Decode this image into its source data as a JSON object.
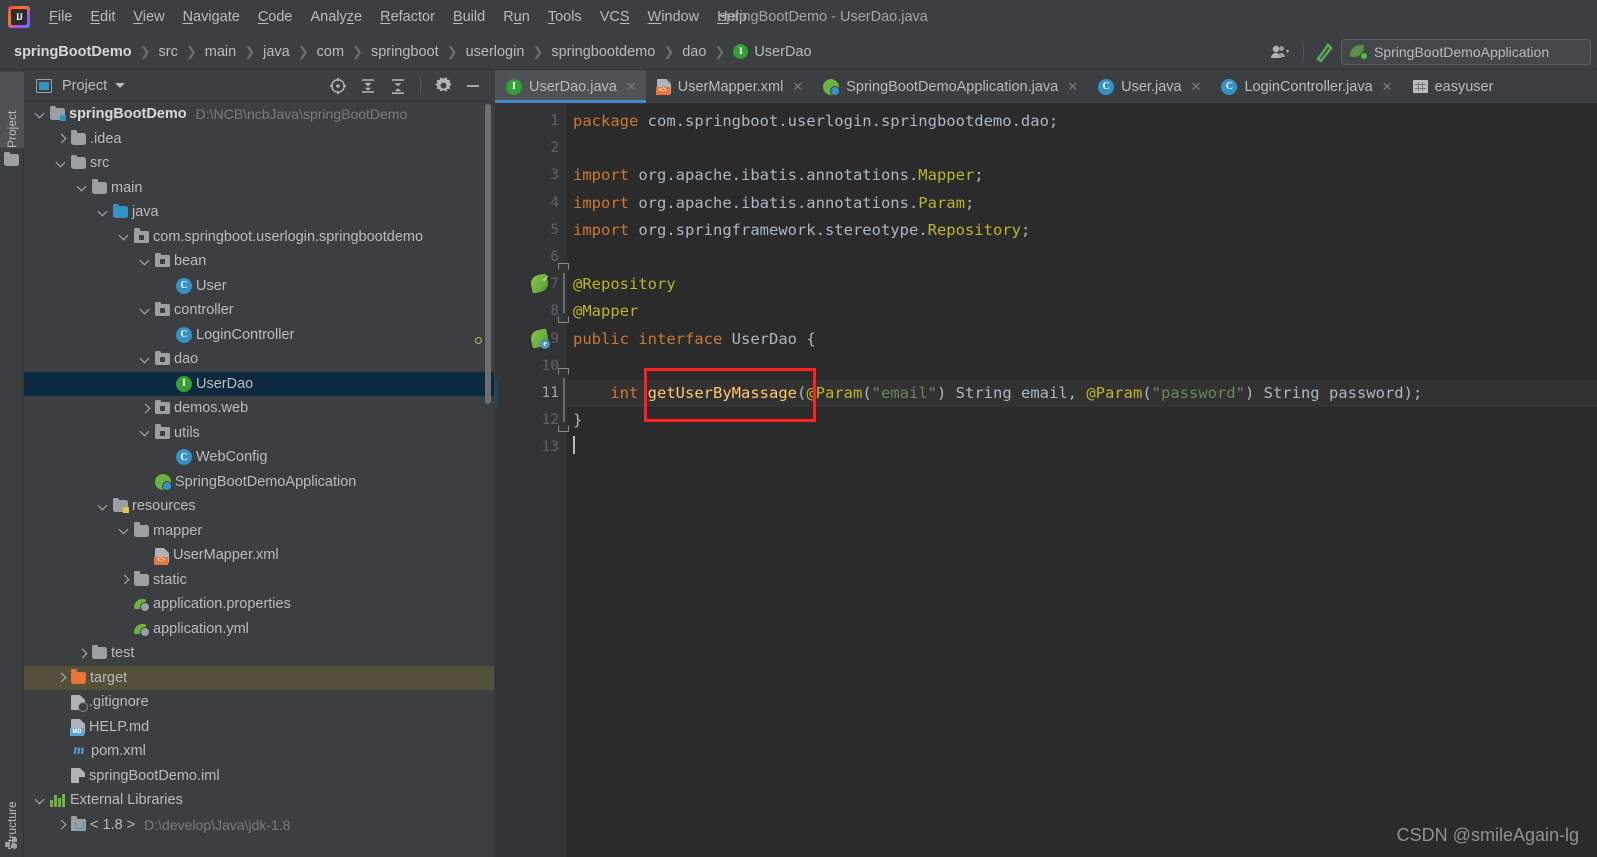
{
  "window": {
    "title": "springBootDemo - UserDao.java"
  },
  "menubar": {
    "items": [
      {
        "label": "File",
        "mnemonic": "F"
      },
      {
        "label": "Edit",
        "mnemonic": "E"
      },
      {
        "label": "View",
        "mnemonic": "V"
      },
      {
        "label": "Navigate",
        "mnemonic": "N"
      },
      {
        "label": "Code",
        "mnemonic": "C"
      },
      {
        "label": "Analyze",
        "mnemonic": "z"
      },
      {
        "label": "Refactor",
        "mnemonic": "R"
      },
      {
        "label": "Build",
        "mnemonic": "B"
      },
      {
        "label": "Run",
        "mnemonic": "u"
      },
      {
        "label": "Tools",
        "mnemonic": "T"
      },
      {
        "label": "VCS",
        "mnemonic": "S"
      },
      {
        "label": "Window",
        "mnemonic": "W"
      },
      {
        "label": "Help",
        "mnemonic": "H"
      }
    ]
  },
  "breadcrumb": {
    "items": [
      "springBootDemo",
      "src",
      "main",
      "java",
      "com",
      "springboot",
      "userlogin",
      "springbootdemo",
      "dao",
      "UserDao"
    ],
    "last_icon": "interface-icon",
    "last_icon_letter": "I"
  },
  "toolbar_right": {
    "account_icon": "user-account-icon",
    "search_icon": "search-everywhere-icon",
    "run_config_label": "SpringBootDemoApplication",
    "run_config_icon": "spring-boot-icon"
  },
  "left_stripe": {
    "top_tab": "Project",
    "bottom_tab": "Structure"
  },
  "project_panel": {
    "title": "Project",
    "title_icon": "project-view-icon",
    "caret_icon": "chevron-down-icon",
    "actions": [
      {
        "name": "scroll-from-source-icon"
      },
      {
        "name": "expand-all-icon"
      },
      {
        "name": "collapse-all-icon"
      },
      {
        "name": "settings-gear-icon"
      },
      {
        "name": "hide-minimize-icon"
      }
    ],
    "tree": [
      {
        "indent": 0,
        "arrow": "down",
        "icon": "folder-module",
        "label": "springBootDemo",
        "bold": true,
        "path": "D:\\NCB\\ncbJava\\springBootDemo",
        "state": "normal"
      },
      {
        "indent": 1,
        "arrow": "right",
        "icon": "folder",
        "label": ".idea",
        "bold": false,
        "path": "",
        "state": "normal"
      },
      {
        "indent": 1,
        "arrow": "down",
        "icon": "folder",
        "label": "src",
        "bold": false,
        "path": "",
        "state": "normal"
      },
      {
        "indent": 2,
        "arrow": "down",
        "icon": "folder",
        "label": "main",
        "bold": false,
        "path": "",
        "state": "normal"
      },
      {
        "indent": 3,
        "arrow": "down",
        "icon": "folder-source",
        "label": "java",
        "bold": false,
        "path": "",
        "state": "normal"
      },
      {
        "indent": 4,
        "arrow": "down",
        "icon": "package",
        "label": "com.springboot.userlogin.springbootdemo",
        "bold": false,
        "path": "",
        "state": "normal"
      },
      {
        "indent": 5,
        "arrow": "down",
        "icon": "package",
        "label": "bean",
        "bold": false,
        "path": "",
        "state": "normal"
      },
      {
        "indent": 6,
        "arrow": "none",
        "icon": "class",
        "label": "User",
        "bold": false,
        "path": "",
        "state": "normal"
      },
      {
        "indent": 5,
        "arrow": "down",
        "icon": "package",
        "label": "controller",
        "bold": false,
        "path": "",
        "state": "normal"
      },
      {
        "indent": 6,
        "arrow": "none",
        "icon": "class",
        "label": "LoginController",
        "bold": false,
        "path": "",
        "state": "normal"
      },
      {
        "indent": 5,
        "arrow": "down",
        "icon": "package",
        "label": "dao",
        "bold": false,
        "path": "",
        "state": "normal"
      },
      {
        "indent": 6,
        "arrow": "none",
        "icon": "interface",
        "label": "UserDao",
        "bold": false,
        "path": "",
        "state": "selected"
      },
      {
        "indent": 5,
        "arrow": "right",
        "icon": "package",
        "label": "demos.web",
        "bold": false,
        "path": "",
        "state": "normal"
      },
      {
        "indent": 5,
        "arrow": "down",
        "icon": "package",
        "label": "utils",
        "bold": false,
        "path": "",
        "state": "normal"
      },
      {
        "indent": 6,
        "arrow": "none",
        "icon": "class",
        "label": "WebConfig",
        "bold": false,
        "path": "",
        "state": "normal"
      },
      {
        "indent": 5,
        "arrow": "none",
        "icon": "spring-boot",
        "label": "SpringBootDemoApplication",
        "bold": false,
        "path": "",
        "state": "normal"
      },
      {
        "indent": 3,
        "arrow": "down",
        "icon": "folder-resource",
        "label": "resources",
        "bold": false,
        "path": "",
        "state": "normal"
      },
      {
        "indent": 4,
        "arrow": "down",
        "icon": "folder",
        "label": "mapper",
        "bold": false,
        "path": "",
        "state": "normal"
      },
      {
        "indent": 5,
        "arrow": "none",
        "icon": "xml-file",
        "label": "UserMapper.xml",
        "bold": false,
        "path": "",
        "state": "normal"
      },
      {
        "indent": 4,
        "arrow": "right",
        "icon": "folder",
        "label": "static",
        "bold": false,
        "path": "",
        "state": "normal"
      },
      {
        "indent": 4,
        "arrow": "none",
        "icon": "properties-file",
        "label": "application.properties",
        "bold": false,
        "path": "",
        "state": "normal"
      },
      {
        "indent": 4,
        "arrow": "none",
        "icon": "properties-file",
        "label": "application.yml",
        "bold": false,
        "path": "",
        "state": "normal"
      },
      {
        "indent": 2,
        "arrow": "right",
        "icon": "folder",
        "label": "test",
        "bold": false,
        "path": "",
        "state": "normal"
      },
      {
        "indent": 1,
        "arrow": "right",
        "icon": "folder-excluded",
        "label": "target",
        "bold": false,
        "path": "",
        "state": "target-highlight"
      },
      {
        "indent": 1,
        "arrow": "none",
        "icon": "gitignore-file",
        "label": ".gitignore",
        "bold": false,
        "path": "",
        "state": "normal"
      },
      {
        "indent": 1,
        "arrow": "none",
        "icon": "markdown-file",
        "label": "HELP.md",
        "bold": false,
        "path": "",
        "state": "normal"
      },
      {
        "indent": 1,
        "arrow": "none",
        "icon": "maven-file",
        "label": "pom.xml",
        "bold": false,
        "path": "",
        "state": "normal"
      },
      {
        "indent": 1,
        "arrow": "none",
        "icon": "iml-file",
        "label": "springBootDemo.iml",
        "bold": false,
        "path": "",
        "state": "normal"
      },
      {
        "indent": 0,
        "arrow": "down",
        "icon": "external-libs",
        "label": "External Libraries",
        "bold": false,
        "path": "",
        "state": "normal"
      },
      {
        "indent": 1,
        "arrow": "right",
        "icon": "jdk",
        "label": "< 1.8 >",
        "bold": false,
        "path": "D:\\develop\\Java\\jdk-1.8",
        "state": "normal"
      }
    ]
  },
  "editor_tabs": [
    {
      "label": "UserDao.java",
      "icon": "interface-icon",
      "icon_letter": "I",
      "active": true,
      "closable": true
    },
    {
      "label": "UserMapper.xml",
      "icon": "xml-file-icon",
      "icon_letter": "",
      "active": false,
      "closable": true
    },
    {
      "label": "SpringBootDemoApplication.java",
      "icon": "spring-boot-icon",
      "icon_letter": "",
      "active": false,
      "closable": true
    },
    {
      "label": "User.java",
      "icon": "class-icon",
      "icon_letter": "C",
      "active": false,
      "closable": true
    },
    {
      "label": "LoginController.java",
      "icon": "class-icon",
      "icon_letter": "C",
      "active": false,
      "closable": true
    },
    {
      "label": "easyuser",
      "icon": "database-table-icon",
      "icon_letter": "",
      "active": false,
      "closable": false
    }
  ],
  "editor": {
    "file": "UserDao.java",
    "current_line": 11,
    "caret_line": 13,
    "line_numbers": [
      1,
      2,
      3,
      4,
      5,
      6,
      7,
      8,
      9,
      10,
      11,
      12,
      13
    ],
    "gutter_markers": [
      {
        "line": 7,
        "icon": "spring-bean-checked-icon"
      },
      {
        "line": 9,
        "icon": "spring-bean-icon"
      }
    ],
    "lines": [
      {
        "n": 1,
        "tokens": [
          {
            "t": "package",
            "c": "kw"
          },
          {
            "t": " com.springboot.userlogin.springbootdemo.dao;",
            "c": "id"
          }
        ]
      },
      {
        "n": 2,
        "tokens": []
      },
      {
        "n": 3,
        "tokens": [
          {
            "t": "import",
            "c": "kw"
          },
          {
            "t": " org.apache.ibatis.annotations.",
            "c": "id"
          },
          {
            "t": "Mapper",
            "c": "yellow"
          },
          {
            "t": ";",
            "c": "id"
          }
        ]
      },
      {
        "n": 4,
        "tokens": [
          {
            "t": "import",
            "c": "kw"
          },
          {
            "t": " org.apache.ibatis.annotations.",
            "c": "id"
          },
          {
            "t": "Param",
            "c": "yellow"
          },
          {
            "t": ";",
            "c": "id"
          }
        ]
      },
      {
        "n": 5,
        "tokens": [
          {
            "t": "import",
            "c": "kw"
          },
          {
            "t": " org.springframework.stereotype.",
            "c": "id"
          },
          {
            "t": "Repository",
            "c": "yellow"
          },
          {
            "t": ";",
            "c": "id"
          }
        ]
      },
      {
        "n": 6,
        "tokens": []
      },
      {
        "n": 7,
        "tokens": [
          {
            "t": "@Repository",
            "c": "ann"
          }
        ]
      },
      {
        "n": 8,
        "tokens": [
          {
            "t": "@Mapper",
            "c": "ann"
          }
        ]
      },
      {
        "n": 9,
        "tokens": [
          {
            "t": "public",
            "c": "kw"
          },
          {
            "t": " ",
            "c": "id"
          },
          {
            "t": "interface",
            "c": "kw"
          },
          {
            "t": " UserDao {",
            "c": "id"
          }
        ]
      },
      {
        "n": 10,
        "tokens": []
      },
      {
        "n": 11,
        "tokens": [
          {
            "t": "    ",
            "c": "id"
          },
          {
            "t": "int",
            "c": "kw"
          },
          {
            "t": " ",
            "c": "id"
          },
          {
            "t": "getUserByMassage",
            "c": "meth"
          },
          {
            "t": "(",
            "c": "id"
          },
          {
            "t": "@Param",
            "c": "ann"
          },
          {
            "t": "(",
            "c": "id"
          },
          {
            "t": "\"email\"",
            "c": "str"
          },
          {
            "t": ") String email, ",
            "c": "id"
          },
          {
            "t": "@Param",
            "c": "ann"
          },
          {
            "t": "(",
            "c": "id"
          },
          {
            "t": "\"password\"",
            "c": "str"
          },
          {
            "t": ") String password);",
            "c": "id"
          }
        ]
      },
      {
        "n": 12,
        "tokens": [
          {
            "t": "}",
            "c": "id"
          }
        ]
      },
      {
        "n": 13,
        "tokens": []
      }
    ],
    "annotation_box": {
      "label": "getUserByMassage",
      "color": "#ff2020"
    }
  },
  "watermark": {
    "text": "CSDN @smileAgain-lg"
  },
  "colors": {
    "bg_chrome": "#3c3f41",
    "bg_editor": "#2b2b2b",
    "gutter": "#313335",
    "accent_blue": "#4a88c7",
    "selection": "#0d293e",
    "target_highlight": "#55503c",
    "keyword_orange": "#cc7832",
    "annotation_yellow": "#bbb529",
    "method_gold": "#ffc66d",
    "string_green": "#6a8759",
    "text_default": "#a9b7c6",
    "red_box": "#ff2020"
  }
}
